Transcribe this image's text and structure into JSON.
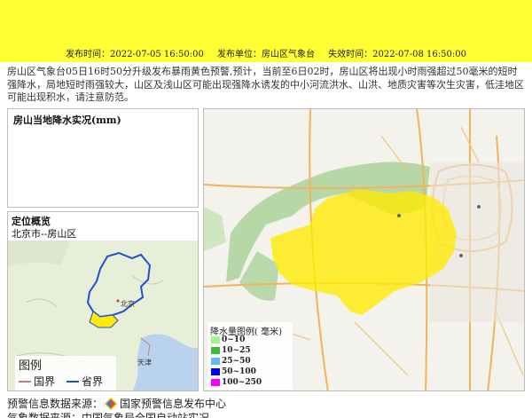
{
  "header": {
    "publish_time": "发布时间：2022-07-05 16:50:00",
    "publisher": "发布单位：房山区气象台",
    "expire_time": "失效时间：2022-07-08 16:50:00",
    "banner_color": "#ffff33"
  },
  "description": "房山区气象台05日16时50分升级发布暴雨黄色预警,预计，当前至6日02时，房山区将出现小时雨强超过50毫米的短时强降水，局地短时雨强较大，山区及浅山区可能出现强降水诱发的中小河流洪水、山洪、地质灾害等次生灾害，低洼地区可能出现积水，请注意防范。",
  "rain_panel": {
    "title": "房山当地降水实况(mm)"
  },
  "location_panel": {
    "title": "定位概览",
    "subtitle": "北京市--房山区",
    "map_labels": [
      "北京",
      "天津"
    ],
    "legend": {
      "title": "图例",
      "items": [
        {
          "label": "国界",
          "color": "#c97b7b"
        },
        {
          "label": "省界",
          "color": "#1f4fcf"
        }
      ]
    }
  },
  "main_map": {
    "legend": {
      "title": "降水量图例( 毫米)",
      "items": [
        {
          "label": "0~10",
          "color": "#a6f28f"
        },
        {
          "label": "10~25",
          "color": "#3dba3d"
        },
        {
          "label": "25~50",
          "color": "#61b8ff"
        },
        {
          "label": "50~100",
          "color": "#0000fe"
        },
        {
          "label": "100~250",
          "color": "#fa00fa"
        }
      ]
    },
    "warning_area_color": "#ffeb00"
  },
  "footer": {
    "source": "预警信息数据来源：",
    "source_org": "国家预警信息发布中心",
    "weather_source": "气象数据来源：中国气象局全国自动站实况"
  }
}
